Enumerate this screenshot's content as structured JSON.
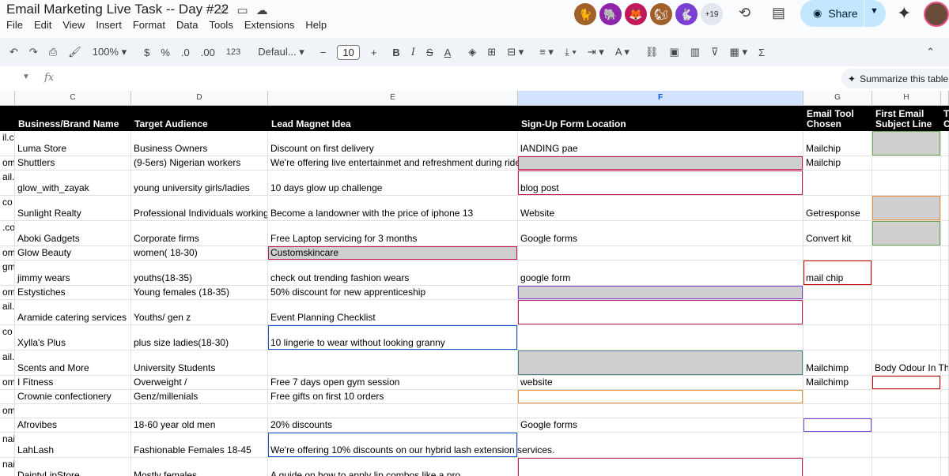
{
  "doc": {
    "title": "Email Marketing Live Task -- Day #22"
  },
  "menu": [
    "File",
    "Edit",
    "View",
    "Insert",
    "Format",
    "Data",
    "Tools",
    "Extensions",
    "Help"
  ],
  "header_icons": [
    "star-icon",
    "folder-move-icon",
    "cloud-status-icon"
  ],
  "collaborators": {
    "avatars": [
      {
        "icon": "cat-icon",
        "color": "#a0602b"
      },
      {
        "icon": "elephant-icon",
        "color": "#8e24aa"
      },
      {
        "icon": "fox-icon",
        "color": "#c2185b"
      },
      {
        "icon": "squirrel-icon",
        "color": "#a0602b"
      },
      {
        "icon": "rabbit-icon",
        "color": "#7b3fd4"
      }
    ],
    "more": "+19"
  },
  "share": {
    "label": "Share"
  },
  "toolbar": {
    "zoom": "100%",
    "currency": "$",
    "percent": "%",
    "dec_decrease": ".0",
    "dec_increase": ".00",
    "number_format": "123",
    "font": "Defaul...",
    "font_size": "10"
  },
  "formula_bar": {
    "fx": "fx",
    "summarize": "Summarize this table"
  },
  "columns": [
    "C",
    "D",
    "E",
    "F",
    "G",
    "H"
  ],
  "headers": {
    "c": "Business/Brand Name",
    "d": "Target Audience",
    "e": "Lead Magnet Idea",
    "f": "Sign-Up Form Location",
    "g1": "Email Tool",
    "g2": "Chosen",
    "h1": "First Email",
    "h2": "Subject Line",
    "i1": "T",
    "i2": "C"
  },
  "rows": [
    {
      "b": "il.c",
      "c": "Luma Store",
      "d": "Business Owners",
      "e": "Discount on first delivery",
      "f": "lANDING pae",
      "g": "Mailchip",
      "h": ""
    },
    {
      "b": "om",
      "c": "Shuttlers",
      "d": "(9-5ers) Nigerian workers",
      "e": "We're offering live entertainmet and refreshment during ride",
      "f": "",
      "g": "Mailchip",
      "h": ""
    },
    {
      "b": "ail.c",
      "c": "glow_with_zayak",
      "d": "young university girls/ladies",
      "e": "10 days glow up challenge",
      "f": "blog post",
      "g": "",
      "h": ""
    },
    {
      "b": "co",
      "c": "Sunlight Realty",
      "d": "Professional Individuals working f",
      "e": "Become a landowner with the price of iphone 13",
      "f": "Website",
      "g": "Getresponse",
      "h": ""
    },
    {
      "b": ".co",
      "c": "Aboki Gadgets",
      "d": "Corporate firms",
      "e": "Free Laptop servicing for 3 months",
      "f": "Google forms",
      "g": " Convert kit",
      "h": ""
    },
    {
      "b": "om",
      "c": "Glow Beauty",
      "d": "women( 18-30)",
      "e": "Customskincare",
      "f": "",
      "g": "",
      "h": ""
    },
    {
      "b": "gm",
      "c": "jimmy wears",
      "d": "youths(18-35)",
      "e": "check out trending fashion wears",
      "f": "google form",
      "g": "mail chip",
      "h": ""
    },
    {
      "b": "om",
      "c": "Estystiches",
      "d": "Young females (18-35)",
      "e": "50% discount for new apprenticeship",
      "f": "",
      "g": "",
      "h": ""
    },
    {
      "b": "ail.",
      "c": "Aramide catering services",
      "d": "Youths/ gen z",
      "e": "Event Planning Checklist",
      "f": "",
      "g": "",
      "h": ""
    },
    {
      "b": "co",
      "c": "Xylla's Plus",
      "d": "plus size ladies(18-30)",
      "e": "10 lingerie to wear without looking granny",
      "f": "",
      "g": "",
      "h": ""
    },
    {
      "b": "ail.",
      "c": "Scents and More",
      "d": "University Students",
      "e": "",
      "f": "",
      "g": "Mailchimp",
      "h": "Body Odour In Thi"
    },
    {
      "b": "om",
      "c": "I Fitness",
      "d": "Overweight /",
      "e": "Free 7 days open gym session",
      "f": "website",
      "g": "Mailchimp",
      "h": ""
    },
    {
      "b": "",
      "c": "Crownie confectionery",
      "d": "Genz/millenials",
      "e": "Free gifts on first 10 orders",
      "f": "",
      "g": "",
      "h": ""
    },
    {
      "b": "om",
      "c": "",
      "d": "",
      "e": "",
      "f": "",
      "g": "",
      "h": ""
    },
    {
      "b": "",
      "c": "Afrovibes",
      "d": "18-60 year old men",
      "e": "20% discounts",
      "f": "Google forms",
      "g": "",
      "h": ""
    },
    {
      "b": "nail",
      "c": "LahLash",
      "d": "Fashionable Females 18-45",
      "e": "We're offering 10% discounts on our hybrid lash extension services.",
      "f": "",
      "g": "",
      "h": ""
    },
    {
      "b": "nail",
      "c": "DaintyLipStore",
      "d": "Mostly females",
      "e": "A guide on how to apply lip combos like a pro",
      "f": "",
      "g": "",
      "h": ""
    }
  ]
}
